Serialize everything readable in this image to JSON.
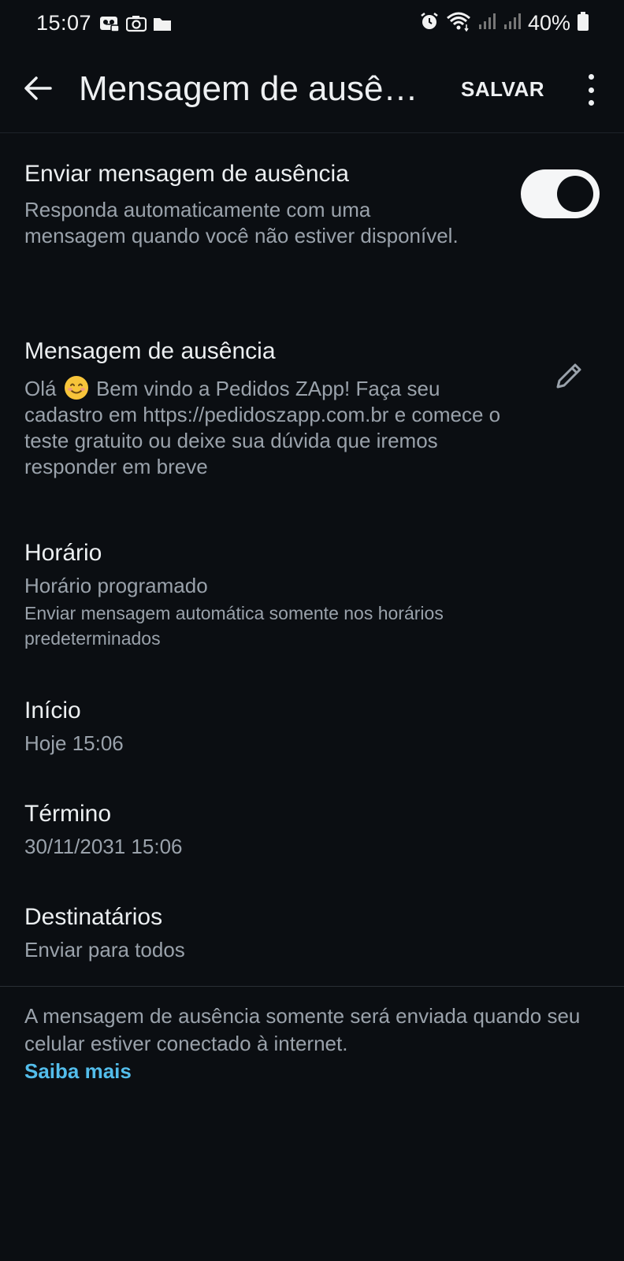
{
  "status_bar": {
    "time": "15:07",
    "battery": "40%",
    "left_icons": [
      "voicemail-icon",
      "camera-icon",
      "folder-icon"
    ],
    "right_icons": [
      "alarm-icon",
      "wifi-icon",
      "signal-icon",
      "signal-icon",
      "battery-icon"
    ]
  },
  "app_bar": {
    "title": "Mensagem de ausê…",
    "save_label": "SALVAR",
    "back_icon": "arrow-left-icon",
    "more_icon": "more-vertical-icon"
  },
  "send_away": {
    "title": "Enviar mensagem de ausência",
    "description": "Responda automaticamente com uma mensagem quando você não estiver disponível.",
    "enabled": true
  },
  "away_message": {
    "title": "Mensagem de ausência",
    "text_before_emoji": "Olá",
    "emoji": "smiling-face-emoji",
    "text_after_emoji": "Bem vindo a Pedidos ZApp! Faça seu cadastro em https://pedidoszapp.com.br e comece o teste gratuito ou deixe sua dúvida que iremos responder em breve",
    "edit_icon": "pencil-icon"
  },
  "schedule": {
    "title": "Horário",
    "value": "Horário programado",
    "description": "Enviar mensagem automática somente nos horários predeterminados"
  },
  "start": {
    "title": "Início",
    "value": "Hoje 15:06"
  },
  "end": {
    "title": "Término",
    "value": "30/11/2031 15:06"
  },
  "recipients": {
    "title": "Destinatários",
    "value": "Enviar para todos"
  },
  "footer": {
    "note": "A mensagem de ausência somente será enviada quando seu celular estiver conectado à internet.",
    "learn_more": "Saiba mais"
  },
  "colors": {
    "background": "#0b0e12",
    "text_primary": "#eceff1",
    "text_secondary": "#9aa2ab",
    "link": "#53bdeb",
    "toggle_track": "#f5f6f7"
  }
}
